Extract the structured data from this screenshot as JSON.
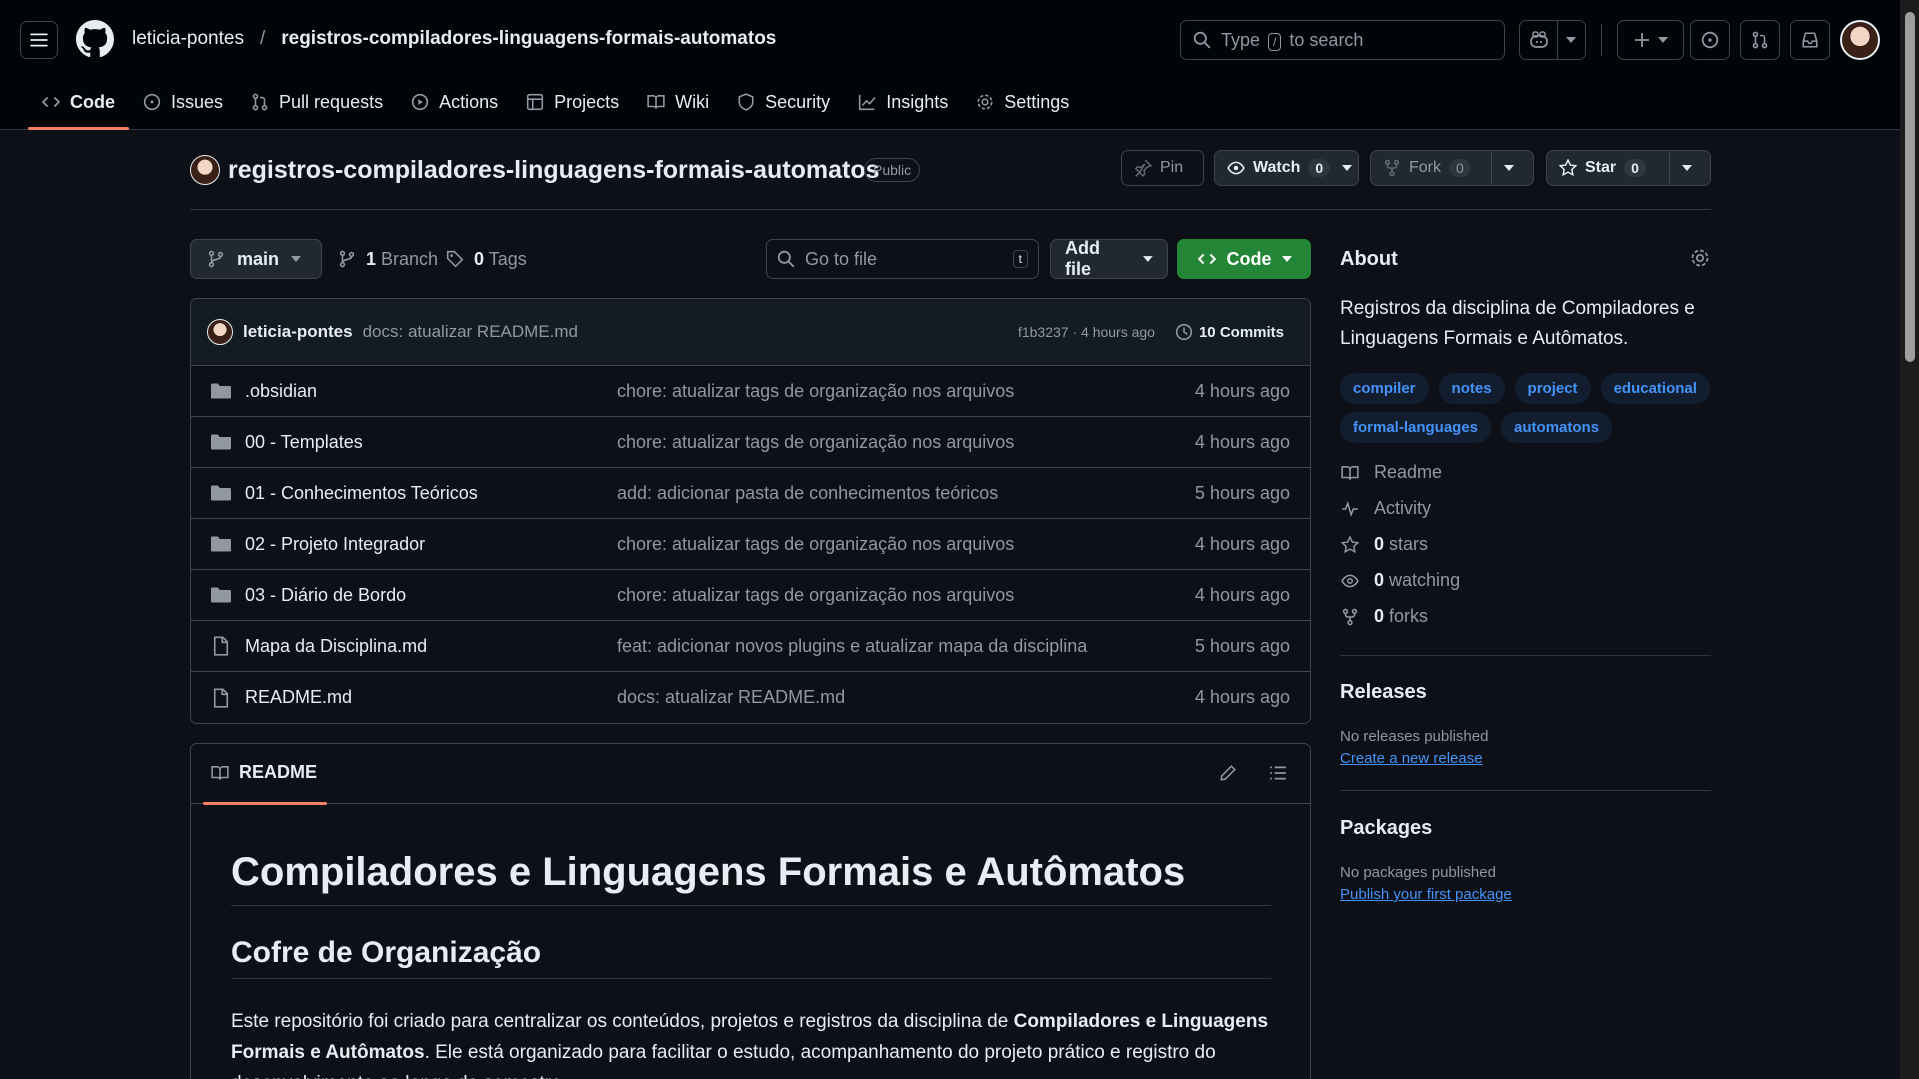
{
  "header": {
    "owner": "leticia-pontes",
    "separator": "/",
    "repo": "registros-compiladores-linguagens-formais-automatos",
    "search_prefix": "Type",
    "search_key": "/",
    "search_suffix": "to search"
  },
  "nav_tabs": [
    {
      "label": "Code",
      "icon": "code-icon"
    },
    {
      "label": "Issues",
      "icon": "issue-icon"
    },
    {
      "label": "Pull requests",
      "icon": "pull-request-icon"
    },
    {
      "label": "Actions",
      "icon": "play-icon"
    },
    {
      "label": "Projects",
      "icon": "table-icon"
    },
    {
      "label": "Wiki",
      "icon": "book-icon"
    },
    {
      "label": "Security",
      "icon": "shield-icon"
    },
    {
      "label": "Insights",
      "icon": "graph-icon"
    },
    {
      "label": "Settings",
      "icon": "gear-icon"
    }
  ],
  "repo_header": {
    "title": "registros-compiladores-linguagens-formais-automatos",
    "visibility": "Public",
    "pin_label": "Pin",
    "watch_label": "Watch",
    "watch_count": "0",
    "fork_label": "Fork",
    "fork_count": "0",
    "star_label": "Star",
    "star_count": "0"
  },
  "controls": {
    "branch": "main",
    "branch_count": "1",
    "branch_label": "Branch",
    "tag_count": "0",
    "tag_label": "Tags",
    "goto_placeholder": "Go to file",
    "goto_key": "t",
    "add_file": "Add file",
    "code": "Code"
  },
  "latest_commit": {
    "author": "leticia-pontes",
    "message": "docs: atualizar README.md",
    "hash_time": "f1b3237 · 4 hours ago",
    "commits": "10 Commits"
  },
  "files": [
    {
      "name": ".obsidian",
      "type": "folder",
      "message": "chore: atualizar tags de organização nos arquivos",
      "time": "4 hours ago"
    },
    {
      "name": "00 - Templates",
      "type": "folder",
      "message": "chore: atualizar tags de organização nos arquivos",
      "time": "4 hours ago"
    },
    {
      "name": "01 - Conhecimentos Teóricos",
      "type": "folder",
      "message": "add: adicionar pasta de conhecimentos teóricos",
      "time": "5 hours ago"
    },
    {
      "name": "02 - Projeto Integrador",
      "type": "folder",
      "message": "chore: atualizar tags de organização nos arquivos",
      "time": "4 hours ago"
    },
    {
      "name": "03 - Diário de Bordo",
      "type": "folder",
      "message": "chore: atualizar tags de organização nos arquivos",
      "time": "4 hours ago"
    },
    {
      "name": "Mapa da Disciplina.md",
      "type": "file",
      "message": "feat: adicionar novos plugins e atualizar mapa da disciplina",
      "time": "5 hours ago"
    },
    {
      "name": "README.md",
      "type": "file",
      "message": "docs: atualizar README.md",
      "time": "4 hours ago"
    }
  ],
  "readme": {
    "tab": "README",
    "h1": "Compiladores e Linguagens Formais e Autômatos",
    "h2": "Cofre de Organização",
    "p_start": "Este repositório foi criado para centralizar os conteúdos, projetos e registros da disciplina de ",
    "p_bold": "Compiladores e Linguagens Formais e Autômatos",
    "p_end": ". Ele está organizado para facilitar o estudo, acompanhamento do projeto prático e registro do desenvolvimento ao longo do semestre."
  },
  "about": {
    "title": "About",
    "description": "Registros da disciplina de Compiladores e Linguagens Formais e Autômatos.",
    "topics": [
      "compiler",
      "notes",
      "project",
      "educational",
      "formal-languages",
      "automatons"
    ],
    "readme": "Readme",
    "activity": "Activity",
    "stars_count": "0",
    "stars_label": "stars",
    "watching_count": "0",
    "watching_label": "watching",
    "forks_count": "0",
    "forks_label": "forks"
  },
  "releases": {
    "title": "Releases",
    "empty": "No releases published",
    "link": "Create a new release"
  },
  "packages": {
    "title": "Packages",
    "empty": "No packages published",
    "link": "Publish your first package"
  },
  "colors": {
    "accent": "#238636",
    "link": "#4493f8",
    "tab_underline": "#f78166",
    "background": "#0d1117"
  }
}
